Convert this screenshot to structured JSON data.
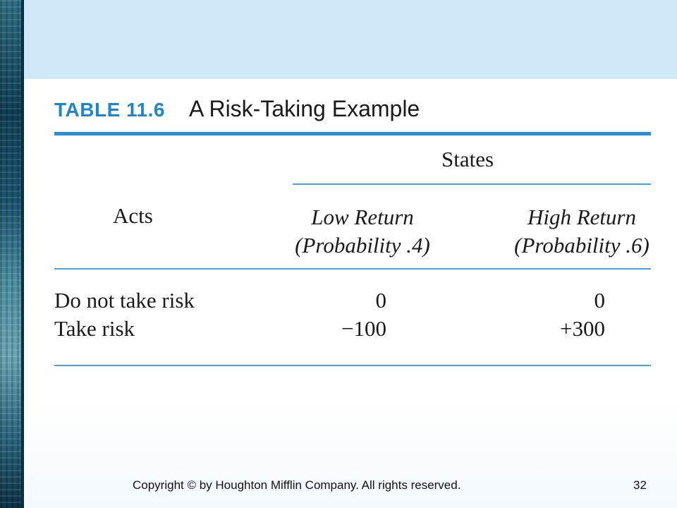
{
  "slide": {
    "table_number": "TABLE 11.6",
    "table_title": "A Risk-Taking Example",
    "accent_color": "#1e86d0",
    "top_band_color": "#cfe9fb"
  },
  "table": {
    "group_header": "States",
    "row_header": "Acts",
    "columns": [
      {
        "name": "Low Return",
        "probability": "(Probability .4)"
      },
      {
        "name": "High Return",
        "probability": "(Probability .6)"
      }
    ],
    "rows": [
      {
        "act": "Do not take risk",
        "values": [
          "0",
          "0"
        ]
      },
      {
        "act": "Take risk",
        "values": [
          "−100",
          "+300"
        ]
      }
    ]
  },
  "footer": {
    "copyright": "Copyright © by Houghton Mifflin Company. All rights reserved.",
    "page_number": "32"
  }
}
